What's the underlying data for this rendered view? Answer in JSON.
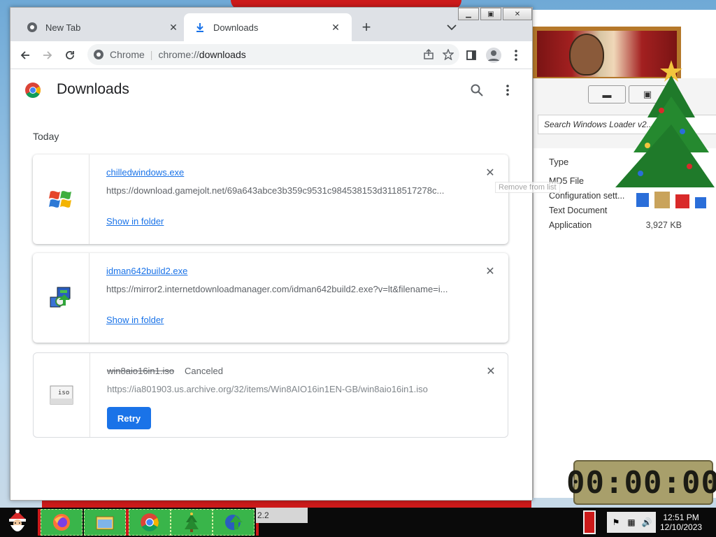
{
  "browser": {
    "tabs": [
      {
        "label": "New Tab",
        "active": false
      },
      {
        "label": "Downloads",
        "active": true
      }
    ],
    "omnibox": {
      "site_label": "Chrome",
      "url_scheme": "chrome://",
      "url_rest": "downloads"
    }
  },
  "page": {
    "title": "Downloads",
    "section_date": "Today",
    "downloads": [
      {
        "filename": "chilledwindows.exe",
        "url": "https://download.gamejolt.net/69a643abce3b359c9531c984538153d3118517278c...",
        "action": "Show in folder",
        "icon": "windows-flag-icon"
      },
      {
        "filename": "idman642build2.exe",
        "url": "https://mirror2.internetdownloadmanager.com/idman642build2.exe?v=lt&filename=i...",
        "action": "Show in folder",
        "icon": "idm-installer-icon"
      },
      {
        "filename": "win8aio16in1.iso",
        "status": "Canceled",
        "url": "https://ia801903.us.archive.org/32/items/Win8AIO16in1EN-GB/win8aio16in1.iso",
        "action": "Retry",
        "icon": "iso-file-icon"
      }
    ],
    "tooltip": "Remove from list"
  },
  "explorer": {
    "search_placeholder": "Search Windows Loader v2...",
    "column_type": "Type",
    "rows": [
      {
        "type": "MD5 File",
        "size": ""
      },
      {
        "type": "Configuration sett...",
        "size": ""
      },
      {
        "type": "Text Document",
        "size": ""
      },
      {
        "type": "Application",
        "size": "3,927 KB"
      }
    ]
  },
  "timer": {
    "display": "00:00:00"
  },
  "taskbar": {
    "active_window_label": "2.2",
    "clock_time": "12:51 PM",
    "clock_date": "12/10/2023"
  },
  "colors": {
    "accent": "#1a73e8",
    "tab_strip": "#dee1e6",
    "taskbar_app": "#39b54a"
  }
}
